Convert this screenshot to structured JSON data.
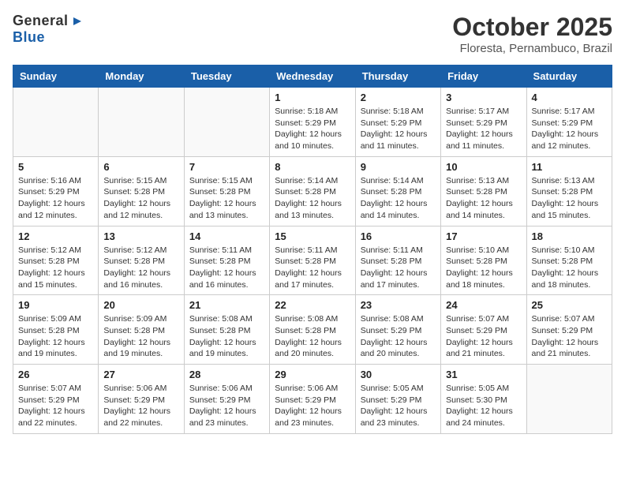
{
  "header": {
    "logo_general": "General",
    "logo_blue": "Blue",
    "month": "October 2025",
    "location": "Floresta, Pernambuco, Brazil"
  },
  "days_of_week": [
    "Sunday",
    "Monday",
    "Tuesday",
    "Wednesday",
    "Thursday",
    "Friday",
    "Saturday"
  ],
  "weeks": [
    [
      {
        "day": "",
        "info": ""
      },
      {
        "day": "",
        "info": ""
      },
      {
        "day": "",
        "info": ""
      },
      {
        "day": "1",
        "info": "Sunrise: 5:18 AM\nSunset: 5:29 PM\nDaylight: 12 hours\nand 10 minutes."
      },
      {
        "day": "2",
        "info": "Sunrise: 5:18 AM\nSunset: 5:29 PM\nDaylight: 12 hours\nand 11 minutes."
      },
      {
        "day": "3",
        "info": "Sunrise: 5:17 AM\nSunset: 5:29 PM\nDaylight: 12 hours\nand 11 minutes."
      },
      {
        "day": "4",
        "info": "Sunrise: 5:17 AM\nSunset: 5:29 PM\nDaylight: 12 hours\nand 12 minutes."
      }
    ],
    [
      {
        "day": "5",
        "info": "Sunrise: 5:16 AM\nSunset: 5:29 PM\nDaylight: 12 hours\nand 12 minutes."
      },
      {
        "day": "6",
        "info": "Sunrise: 5:15 AM\nSunset: 5:28 PM\nDaylight: 12 hours\nand 12 minutes."
      },
      {
        "day": "7",
        "info": "Sunrise: 5:15 AM\nSunset: 5:28 PM\nDaylight: 12 hours\nand 13 minutes."
      },
      {
        "day": "8",
        "info": "Sunrise: 5:14 AM\nSunset: 5:28 PM\nDaylight: 12 hours\nand 13 minutes."
      },
      {
        "day": "9",
        "info": "Sunrise: 5:14 AM\nSunset: 5:28 PM\nDaylight: 12 hours\nand 14 minutes."
      },
      {
        "day": "10",
        "info": "Sunrise: 5:13 AM\nSunset: 5:28 PM\nDaylight: 12 hours\nand 14 minutes."
      },
      {
        "day": "11",
        "info": "Sunrise: 5:13 AM\nSunset: 5:28 PM\nDaylight: 12 hours\nand 15 minutes."
      }
    ],
    [
      {
        "day": "12",
        "info": "Sunrise: 5:12 AM\nSunset: 5:28 PM\nDaylight: 12 hours\nand 15 minutes."
      },
      {
        "day": "13",
        "info": "Sunrise: 5:12 AM\nSunset: 5:28 PM\nDaylight: 12 hours\nand 16 minutes."
      },
      {
        "day": "14",
        "info": "Sunrise: 5:11 AM\nSunset: 5:28 PM\nDaylight: 12 hours\nand 16 minutes."
      },
      {
        "day": "15",
        "info": "Sunrise: 5:11 AM\nSunset: 5:28 PM\nDaylight: 12 hours\nand 17 minutes."
      },
      {
        "day": "16",
        "info": "Sunrise: 5:11 AM\nSunset: 5:28 PM\nDaylight: 12 hours\nand 17 minutes."
      },
      {
        "day": "17",
        "info": "Sunrise: 5:10 AM\nSunset: 5:28 PM\nDaylight: 12 hours\nand 18 minutes."
      },
      {
        "day": "18",
        "info": "Sunrise: 5:10 AM\nSunset: 5:28 PM\nDaylight: 12 hours\nand 18 minutes."
      }
    ],
    [
      {
        "day": "19",
        "info": "Sunrise: 5:09 AM\nSunset: 5:28 PM\nDaylight: 12 hours\nand 19 minutes."
      },
      {
        "day": "20",
        "info": "Sunrise: 5:09 AM\nSunset: 5:28 PM\nDaylight: 12 hours\nand 19 minutes."
      },
      {
        "day": "21",
        "info": "Sunrise: 5:08 AM\nSunset: 5:28 PM\nDaylight: 12 hours\nand 19 minutes."
      },
      {
        "day": "22",
        "info": "Sunrise: 5:08 AM\nSunset: 5:28 PM\nDaylight: 12 hours\nand 20 minutes."
      },
      {
        "day": "23",
        "info": "Sunrise: 5:08 AM\nSunset: 5:29 PM\nDaylight: 12 hours\nand 20 minutes."
      },
      {
        "day": "24",
        "info": "Sunrise: 5:07 AM\nSunset: 5:29 PM\nDaylight: 12 hours\nand 21 minutes."
      },
      {
        "day": "25",
        "info": "Sunrise: 5:07 AM\nSunset: 5:29 PM\nDaylight: 12 hours\nand 21 minutes."
      }
    ],
    [
      {
        "day": "26",
        "info": "Sunrise: 5:07 AM\nSunset: 5:29 PM\nDaylight: 12 hours\nand 22 minutes."
      },
      {
        "day": "27",
        "info": "Sunrise: 5:06 AM\nSunset: 5:29 PM\nDaylight: 12 hours\nand 22 minutes."
      },
      {
        "day": "28",
        "info": "Sunrise: 5:06 AM\nSunset: 5:29 PM\nDaylight: 12 hours\nand 23 minutes."
      },
      {
        "day": "29",
        "info": "Sunrise: 5:06 AM\nSunset: 5:29 PM\nDaylight: 12 hours\nand 23 minutes."
      },
      {
        "day": "30",
        "info": "Sunrise: 5:05 AM\nSunset: 5:29 PM\nDaylight: 12 hours\nand 23 minutes."
      },
      {
        "day": "31",
        "info": "Sunrise: 5:05 AM\nSunset: 5:30 PM\nDaylight: 12 hours\nand 24 minutes."
      },
      {
        "day": "",
        "info": ""
      }
    ]
  ]
}
